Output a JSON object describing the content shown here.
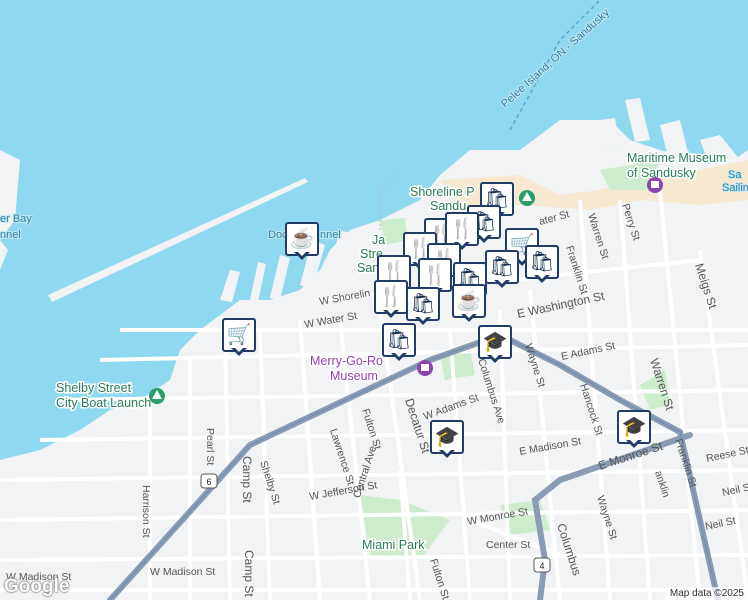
{
  "map": {
    "water_labels": [
      "Pelee Island, ON - Sandusky",
      "er Bay",
      "nnel",
      "Dock",
      "nnel"
    ],
    "poi_labels": {
      "maritime": [
        "Maritime Museum",
        "of Sandusky"
      ],
      "shoreline": [
        "Shoreline P",
        "Sandu"
      ],
      "jackson": [
        "Ja",
        "Stre",
        "San"
      ],
      "merry": [
        "Merry-Go-Ro",
        "Museum"
      ],
      "shelby": [
        "Shelby Street",
        "City Boat Launch"
      ],
      "miami": "Miami Park",
      "sandusky_sailing": [
        "Sa",
        "Sailin"
      ]
    },
    "streets": [
      "W Shorelin",
      "W Water St",
      "ater St",
      "E Washington St",
      "E Adams St",
      "W Adams St",
      "Columbus Ave",
      "Wayne St",
      "Hancock St",
      "Warren St",
      "Meigs St",
      "Perry St",
      "Warren St",
      "Franklin St",
      "E Madison St",
      "E Monroe St",
      "Reese St",
      "Neil St",
      "Neil St",
      "Fulton St",
      "Lawrence St",
      "Decatur St",
      "Central Ave",
      "W Jefferson St",
      "Shelby St",
      "Camp St",
      "Pearl St",
      "Harrison St",
      "W Madison St",
      "W Madison St",
      "W Monroe St",
      "Center St",
      "Columbus",
      "Fulton St",
      "Wayne St",
      "Franklin St",
      "anklin",
      "Camp St"
    ],
    "route_shields": [
      "6",
      "4"
    ],
    "google_logo": "Google",
    "attribution": "Map data ©2025"
  },
  "markers": [
    {
      "icon": "coffee-icon",
      "glyph": "☕"
    },
    {
      "icon": "cart-icon",
      "glyph": "🛒"
    },
    {
      "icon": "shopping-bag-icon",
      "glyph": "🛍"
    },
    {
      "icon": "restaurant-icon",
      "glyph": "🍴"
    },
    {
      "icon": "graduation-cap-icon",
      "glyph": "🎓"
    }
  ]
}
